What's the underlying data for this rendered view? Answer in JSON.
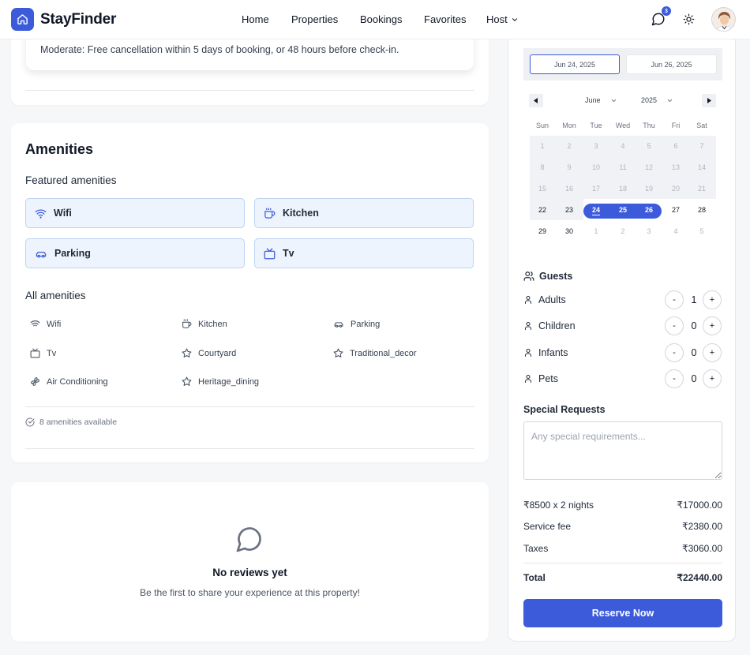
{
  "header": {
    "brand": "StayFinder",
    "nav": [
      {
        "label": "Home"
      },
      {
        "label": "Properties"
      },
      {
        "label": "Bookings"
      },
      {
        "label": "Favorites"
      },
      {
        "label": "Host"
      }
    ],
    "notifications_count": "3",
    "accent_color": "#3b5bdb"
  },
  "policy": {
    "text": "Moderate: Free cancellation within 5 days of booking, or 48 hours before check-in."
  },
  "amenities": {
    "title": "Amenities",
    "featured_title": "Featured amenities",
    "featured": [
      {
        "label": "Wifi",
        "icon": "wifi-icon"
      },
      {
        "label": "Kitchen",
        "icon": "coffee-cup-icon"
      },
      {
        "label": "Parking",
        "icon": "car-icon"
      },
      {
        "label": "Tv",
        "icon": "tv-icon"
      }
    ],
    "all_title": "All amenities",
    "all": [
      {
        "label": "Wifi",
        "icon": "wifi-icon"
      },
      {
        "label": "Kitchen",
        "icon": "coffee-cup-icon"
      },
      {
        "label": "Parking",
        "icon": "car-icon"
      },
      {
        "label": "Tv",
        "icon": "tv-icon"
      },
      {
        "label": "Courtyard",
        "icon": "star-icon"
      },
      {
        "label": "Traditional_decor",
        "icon": "star-icon"
      },
      {
        "label": "Air Conditioning",
        "icon": "fan-icon"
      },
      {
        "label": "Heritage_dining",
        "icon": "star-icon"
      }
    ],
    "count_text": "8 amenities available"
  },
  "reviews": {
    "title": "No reviews yet",
    "subtitle": "Be the first to share your experience at this property!"
  },
  "booking": {
    "check_in": "Jun 24, 2025",
    "check_out": "Jun 26, 2025",
    "calendar": {
      "month": "June",
      "year": "2025",
      "weekdays": [
        "Sun",
        "Mon",
        "Tue",
        "Wed",
        "Thu",
        "Fri",
        "Sat"
      ],
      "weeks": [
        [
          "1",
          "2",
          "3",
          "4",
          "5",
          "6",
          "7"
        ],
        [
          "8",
          "9",
          "10",
          "11",
          "12",
          "13",
          "14"
        ],
        [
          "15",
          "16",
          "17",
          "18",
          "19",
          "20",
          "21"
        ],
        [
          "22",
          "23",
          "24",
          "25",
          "26",
          "27",
          "28"
        ],
        [
          "29",
          "30",
          "1",
          "2",
          "3",
          "4",
          "5"
        ]
      ],
      "selected_start": "24",
      "selected_end": "26"
    },
    "guests_title": "Guests",
    "guests": [
      {
        "label": "Adults",
        "value": "1"
      },
      {
        "label": "Children",
        "value": "0"
      },
      {
        "label": "Infants",
        "value": "0"
      },
      {
        "label": "Pets",
        "value": "0"
      }
    ],
    "special_requests_title": "Special Requests",
    "special_requests_placeholder": "Any special requirements...",
    "special_requests_value": "",
    "prices": [
      {
        "label": "₹8500 x 2 nights",
        "value": "₹17000.00"
      },
      {
        "label": "Service fee",
        "value": "₹2380.00"
      },
      {
        "label": "Taxes",
        "value": "₹3060.00"
      }
    ],
    "total_label": "Total",
    "total_value": "₹22440.00",
    "reserve_label": "Reserve Now"
  }
}
